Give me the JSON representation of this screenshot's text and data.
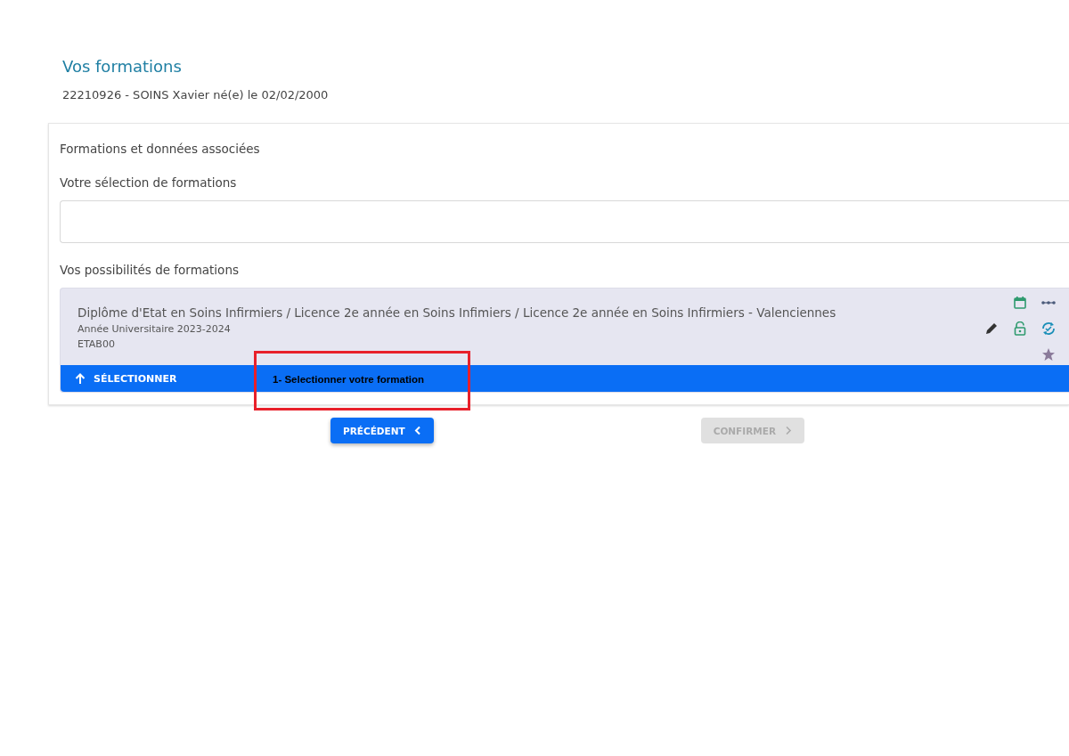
{
  "page": {
    "title": "Vos formations",
    "subtitle": "22210926 - SOINS Xavier né(e) le 02/02/2000"
  },
  "panel": {
    "heading": "Formations et données associées",
    "selection_label": "Votre sélection de formations",
    "possibilities_label": "Vos possibilités de formations"
  },
  "formation": {
    "title": "Diplôme d'Etat en Soins Infirmiers / Licence 2e année en Soins Infimiers / Licence 2e année en Soins Infirmiers - Valenciennes",
    "year": "Année Universitaire 2023-2024",
    "code": "ETAB00",
    "select_label": "SÉLECTIONNER"
  },
  "annotation": {
    "text": "1- Selectionner votre formation"
  },
  "buttons": [
    {
      "label": "PRÉCÉDENT",
      "kind": "back",
      "disabled": false
    },
    {
      "label": "CONFIRMER",
      "kind": "next",
      "disabled": true
    }
  ]
}
